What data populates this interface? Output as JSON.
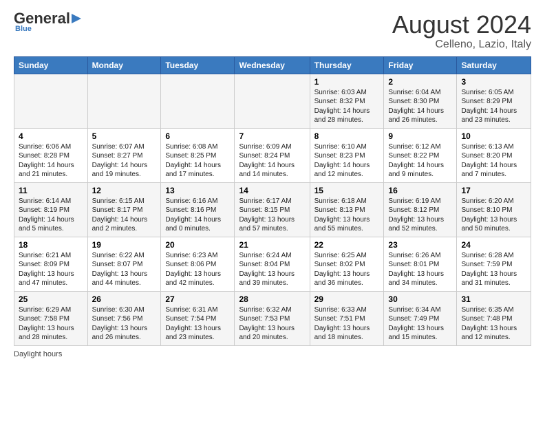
{
  "header": {
    "logo_general": "General",
    "logo_blue": "Blue",
    "title": "August 2024",
    "subtitle": "Celleno, Lazio, Italy"
  },
  "days_of_week": [
    "Sunday",
    "Monday",
    "Tuesday",
    "Wednesday",
    "Thursday",
    "Friday",
    "Saturday"
  ],
  "weeks": [
    [
      {
        "day": "",
        "info": ""
      },
      {
        "day": "",
        "info": ""
      },
      {
        "day": "",
        "info": ""
      },
      {
        "day": "",
        "info": ""
      },
      {
        "day": "1",
        "info": "Sunrise: 6:03 AM\nSunset: 8:32 PM\nDaylight: 14 hours and 28 minutes."
      },
      {
        "day": "2",
        "info": "Sunrise: 6:04 AM\nSunset: 8:30 PM\nDaylight: 14 hours and 26 minutes."
      },
      {
        "day": "3",
        "info": "Sunrise: 6:05 AM\nSunset: 8:29 PM\nDaylight: 14 hours and 23 minutes."
      }
    ],
    [
      {
        "day": "4",
        "info": "Sunrise: 6:06 AM\nSunset: 8:28 PM\nDaylight: 14 hours and 21 minutes."
      },
      {
        "day": "5",
        "info": "Sunrise: 6:07 AM\nSunset: 8:27 PM\nDaylight: 14 hours and 19 minutes."
      },
      {
        "day": "6",
        "info": "Sunrise: 6:08 AM\nSunset: 8:25 PM\nDaylight: 14 hours and 17 minutes."
      },
      {
        "day": "7",
        "info": "Sunrise: 6:09 AM\nSunset: 8:24 PM\nDaylight: 14 hours and 14 minutes."
      },
      {
        "day": "8",
        "info": "Sunrise: 6:10 AM\nSunset: 8:23 PM\nDaylight: 14 hours and 12 minutes."
      },
      {
        "day": "9",
        "info": "Sunrise: 6:12 AM\nSunset: 8:22 PM\nDaylight: 14 hours and 9 minutes."
      },
      {
        "day": "10",
        "info": "Sunrise: 6:13 AM\nSunset: 8:20 PM\nDaylight: 14 hours and 7 minutes."
      }
    ],
    [
      {
        "day": "11",
        "info": "Sunrise: 6:14 AM\nSunset: 8:19 PM\nDaylight: 14 hours and 5 minutes."
      },
      {
        "day": "12",
        "info": "Sunrise: 6:15 AM\nSunset: 8:17 PM\nDaylight: 14 hours and 2 minutes."
      },
      {
        "day": "13",
        "info": "Sunrise: 6:16 AM\nSunset: 8:16 PM\nDaylight: 14 hours and 0 minutes."
      },
      {
        "day": "14",
        "info": "Sunrise: 6:17 AM\nSunset: 8:15 PM\nDaylight: 13 hours and 57 minutes."
      },
      {
        "day": "15",
        "info": "Sunrise: 6:18 AM\nSunset: 8:13 PM\nDaylight: 13 hours and 55 minutes."
      },
      {
        "day": "16",
        "info": "Sunrise: 6:19 AM\nSunset: 8:12 PM\nDaylight: 13 hours and 52 minutes."
      },
      {
        "day": "17",
        "info": "Sunrise: 6:20 AM\nSunset: 8:10 PM\nDaylight: 13 hours and 50 minutes."
      }
    ],
    [
      {
        "day": "18",
        "info": "Sunrise: 6:21 AM\nSunset: 8:09 PM\nDaylight: 13 hours and 47 minutes."
      },
      {
        "day": "19",
        "info": "Sunrise: 6:22 AM\nSunset: 8:07 PM\nDaylight: 13 hours and 44 minutes."
      },
      {
        "day": "20",
        "info": "Sunrise: 6:23 AM\nSunset: 8:06 PM\nDaylight: 13 hours and 42 minutes."
      },
      {
        "day": "21",
        "info": "Sunrise: 6:24 AM\nSunset: 8:04 PM\nDaylight: 13 hours and 39 minutes."
      },
      {
        "day": "22",
        "info": "Sunrise: 6:25 AM\nSunset: 8:02 PM\nDaylight: 13 hours and 36 minutes."
      },
      {
        "day": "23",
        "info": "Sunrise: 6:26 AM\nSunset: 8:01 PM\nDaylight: 13 hours and 34 minutes."
      },
      {
        "day": "24",
        "info": "Sunrise: 6:28 AM\nSunset: 7:59 PM\nDaylight: 13 hours and 31 minutes."
      }
    ],
    [
      {
        "day": "25",
        "info": "Sunrise: 6:29 AM\nSunset: 7:58 PM\nDaylight: 13 hours and 28 minutes."
      },
      {
        "day": "26",
        "info": "Sunrise: 6:30 AM\nSunset: 7:56 PM\nDaylight: 13 hours and 26 minutes."
      },
      {
        "day": "27",
        "info": "Sunrise: 6:31 AM\nSunset: 7:54 PM\nDaylight: 13 hours and 23 minutes."
      },
      {
        "day": "28",
        "info": "Sunrise: 6:32 AM\nSunset: 7:53 PM\nDaylight: 13 hours and 20 minutes."
      },
      {
        "day": "29",
        "info": "Sunrise: 6:33 AM\nSunset: 7:51 PM\nDaylight: 13 hours and 18 minutes."
      },
      {
        "day": "30",
        "info": "Sunrise: 6:34 AM\nSunset: 7:49 PM\nDaylight: 13 hours and 15 minutes."
      },
      {
        "day": "31",
        "info": "Sunrise: 6:35 AM\nSunset: 7:48 PM\nDaylight: 13 hours and 12 minutes."
      }
    ]
  ],
  "footer": {
    "note": "Daylight hours"
  }
}
